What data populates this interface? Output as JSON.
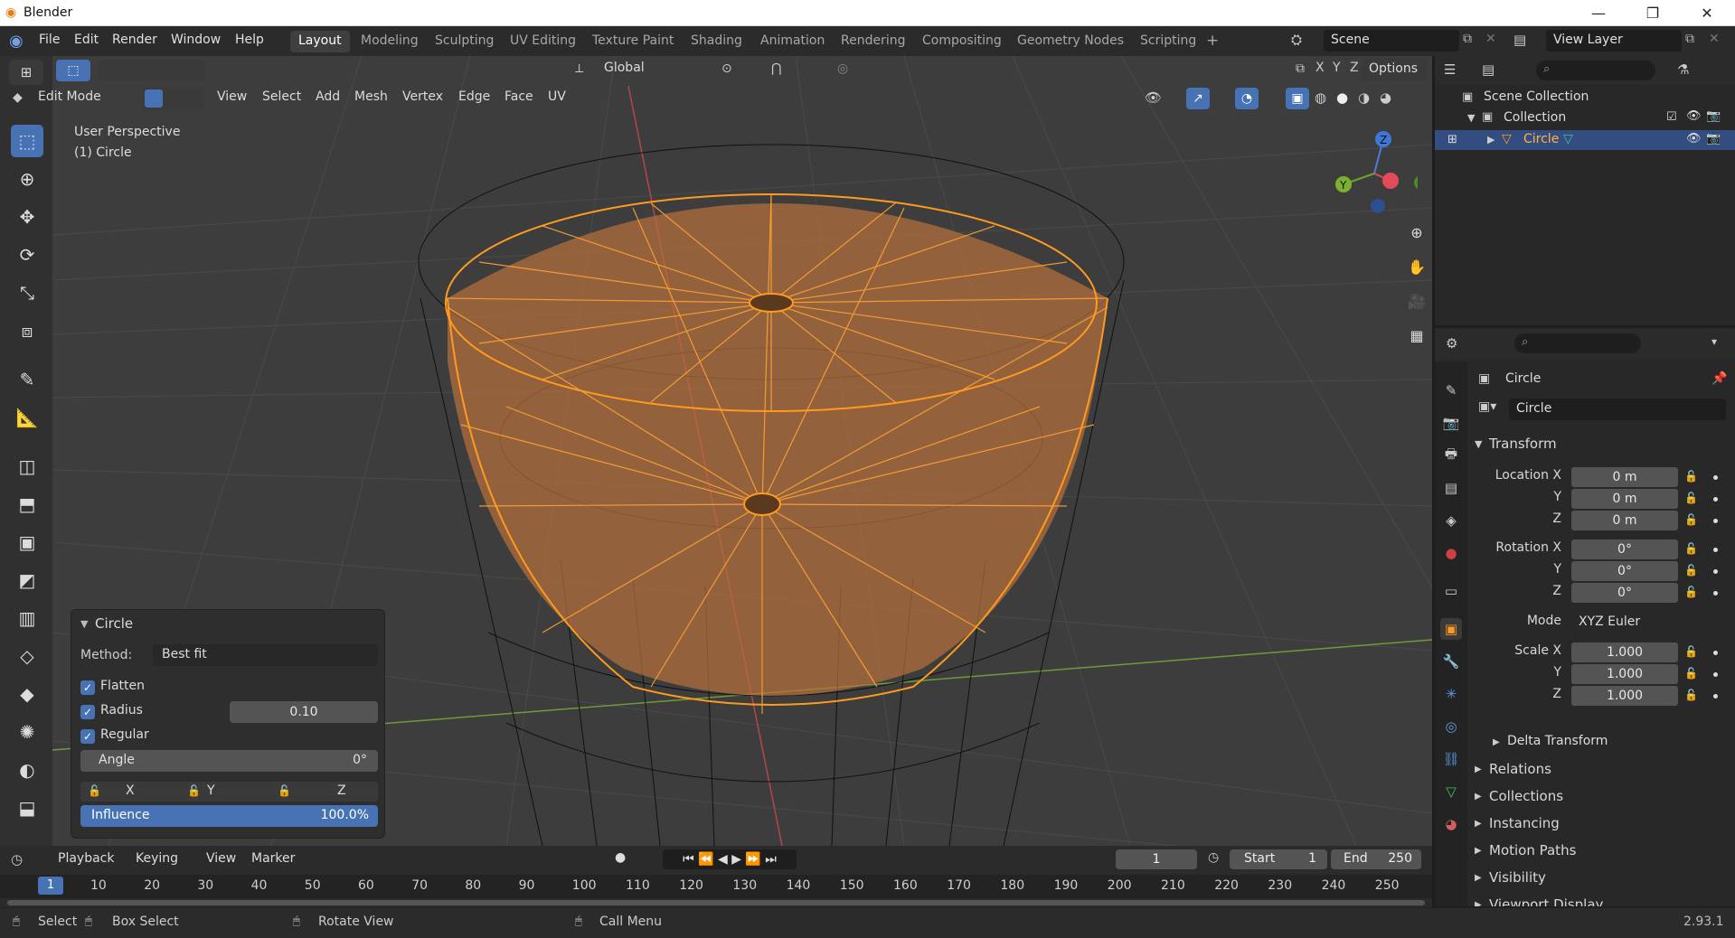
{
  "window": {
    "title": "Blender",
    "controls": [
      "—",
      "❐",
      "✕"
    ]
  },
  "menu": {
    "items": [
      "File",
      "Edit",
      "Render",
      "Window",
      "Help"
    ]
  },
  "workspaces": [
    "Layout",
    "Modeling",
    "Sculpting",
    "UV Editing",
    "Texture Paint",
    "Shading",
    "Animation",
    "Rendering",
    "Compositing",
    "Geometry Nodes",
    "Scripting"
  ],
  "workspace_active": "Layout",
  "scene": {
    "name": "Scene",
    "view_layer": "View Layer"
  },
  "viewport_header": {
    "mode": "Edit Mode",
    "menus": [
      "View",
      "Select",
      "Add",
      "Mesh",
      "Vertex",
      "Edge",
      "Face",
      "UV"
    ],
    "transform_orientation": "Global",
    "options": "Options",
    "axes": [
      "X",
      "Y",
      "Z"
    ]
  },
  "viewport": {
    "perspective": "User Perspective",
    "object": "(1) Circle"
  },
  "gizmo": {
    "z": "Z",
    "y": "Y"
  },
  "outliner": {
    "scene_collection": "Scene Collection",
    "collection": "Collection",
    "object": "Circle"
  },
  "properties": {
    "object_name": "Circle",
    "data_name": "Circle",
    "transform_title": "Transform",
    "location_label": "Location X",
    "rotation_label": "Rotation X",
    "scale_label": "Scale X",
    "y": "Y",
    "z": "Z",
    "location": [
      "0 m",
      "0 m",
      "0 m"
    ],
    "rotation": [
      "0°",
      "0°",
      "0°"
    ],
    "mode_label": "Mode",
    "mode_value": "XYZ Euler",
    "scale": [
      "1.000",
      "1.000",
      "1.000"
    ],
    "delta_transform": "Delta Transform",
    "sections": [
      "Relations",
      "Collections",
      "Instancing",
      "Motion Paths",
      "Visibility",
      "Viewport Display"
    ]
  },
  "redo_panel": {
    "title": "Circle",
    "method_label": "Method:",
    "method_value": "Best fit",
    "flatten": "Flatten",
    "radius": "Radius",
    "radius_value": "0.10",
    "regular": "Regular",
    "angle_label": "Angle",
    "angle_value": "0°",
    "lock_x": "X",
    "lock_y": "Y",
    "lock_z": "Z",
    "influence_label": "Influence",
    "influence_value": "100.0%"
  },
  "timeline": {
    "menus": [
      "Playback",
      "Keying",
      "View",
      "Marker"
    ],
    "current_frame": "1",
    "start_label": "Start",
    "start": "1",
    "end_label": "End",
    "end": "250",
    "frame_marker": "1",
    "ticks": [
      "10",
      "20",
      "30",
      "40",
      "50",
      "60",
      "70",
      "80",
      "90",
      "100",
      "110",
      "120",
      "130",
      "140",
      "150",
      "160",
      "170",
      "180",
      "190",
      "200",
      "210",
      "220",
      "230",
      "240",
      "250"
    ]
  },
  "statusbar": {
    "select": "Select",
    "box_select": "Box Select",
    "rotate_view": "Rotate View",
    "call_menu": "Call Menu",
    "version": "2.93.1"
  },
  "colors": {
    "accent": "#4772b3",
    "selection_orange": "#ff9a1f",
    "viewport_bg": "#3d3d3d"
  }
}
